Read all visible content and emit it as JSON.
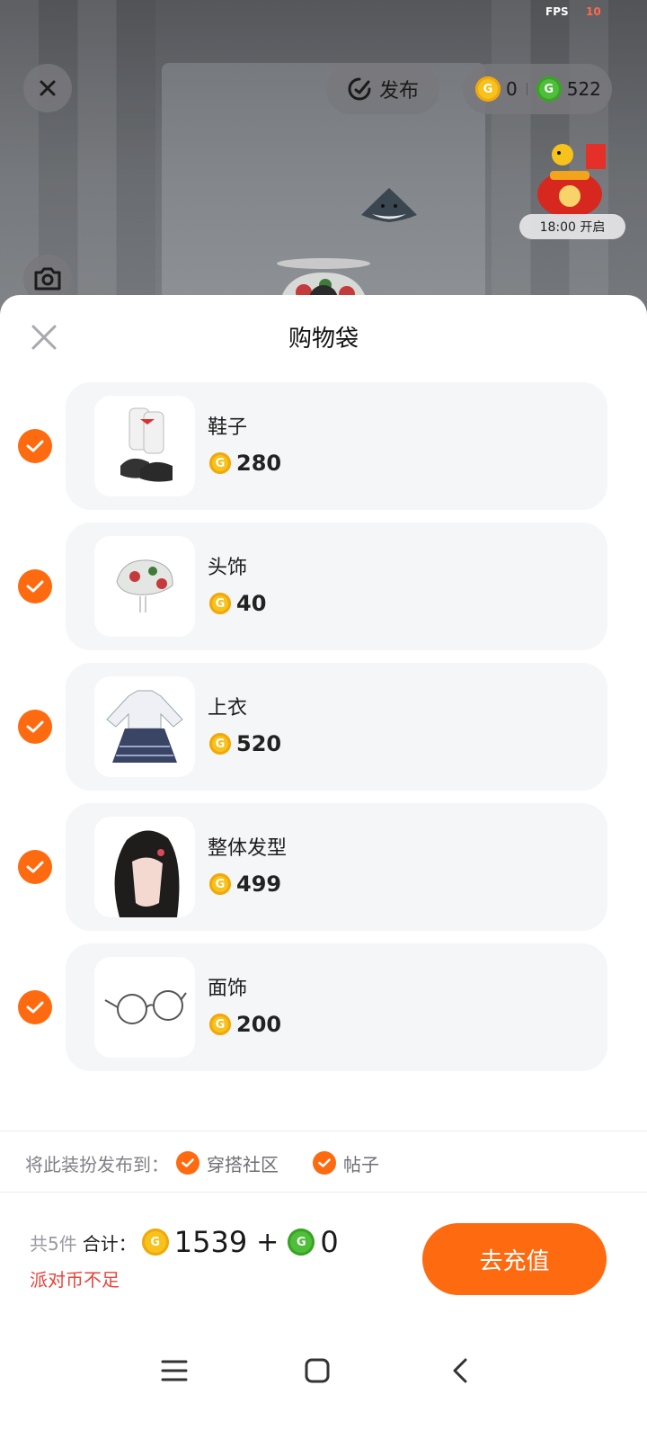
{
  "status": {
    "fps_label": "FPS",
    "fps_value": "10"
  },
  "topbar": {
    "publish_label": "发布",
    "gold_coins": "0",
    "green_coins": "522",
    "event_time_label": "18:00 开启"
  },
  "sheet": {
    "title": "购物袋",
    "items": [
      {
        "name": "鞋子",
        "price": "280",
        "checked": true,
        "icon": "shoes-image"
      },
      {
        "name": "头饰",
        "price": "40",
        "checked": true,
        "icon": "beret-hat-image"
      },
      {
        "name": "上衣",
        "price": "520",
        "checked": true,
        "icon": "dress-top-image"
      },
      {
        "name": "整体发型",
        "price": "499",
        "checked": true,
        "icon": "hairstyle-image"
      },
      {
        "name": "面饰",
        "price": "200",
        "checked": true,
        "icon": "glasses-image"
      }
    ],
    "publish_to_label": "将此装扮发布到：",
    "publish_options": [
      {
        "label": "穿搭社区",
        "checked": true
      },
      {
        "label": "帖子",
        "checked": true
      }
    ]
  },
  "footer": {
    "count_text": "共5件",
    "total_label": "合计：",
    "gold_total": "1539",
    "plus": "+",
    "green_total": "0",
    "warning": "派对币不足",
    "recharge_label": "去充值"
  },
  "colors": {
    "accent": "#fe6a10",
    "warning": "#e9423a",
    "gold": "#f7c21c",
    "green": "#4fbe3a"
  },
  "navbar": {
    "icons": [
      "menu-icon",
      "home-square-icon",
      "back-icon"
    ]
  }
}
